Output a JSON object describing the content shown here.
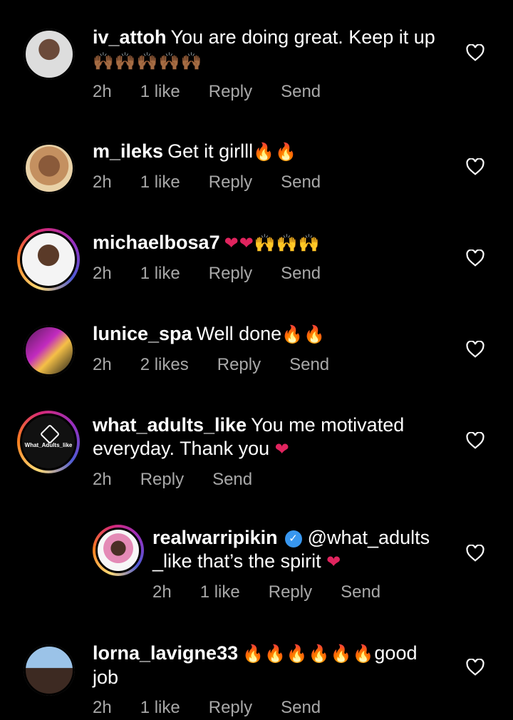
{
  "comments": [
    {
      "username": "iv_attoh",
      "text": "You are doing great. Keep it up",
      "emojis": "🙌🏾🙌🏾🙌🏾🙌🏾🙌🏾",
      "time": "2h",
      "likes": "1 like",
      "reply": "Reply",
      "send": "Send"
    },
    {
      "username": "m_ileks",
      "text": "Get it girlll",
      "emojis": "🔥🔥",
      "time": "2h",
      "likes": "1 like",
      "reply": "Reply",
      "send": "Send"
    },
    {
      "username": "michaelbosa7",
      "text": "",
      "emojis": "❤❤🙌🙌🙌",
      "time": "2h",
      "likes": "1 like",
      "reply": "Reply",
      "send": "Send"
    },
    {
      "username": "lunice_spa",
      "text": "Well done",
      "emojis": "🔥🔥",
      "time": "2h",
      "likes": "2 likes",
      "reply": "Reply",
      "send": "Send"
    },
    {
      "username": "what_adults_like",
      "text": "You me motivated everyday. Thank you",
      "emojis": "❤",
      "time": "2h",
      "reply": "Reply",
      "send": "Send",
      "avatar_text": "What_Adults_like"
    },
    {
      "username": "realwarripikin",
      "text": "@what_adults _like that’s the spirit",
      "emojis": "❤",
      "time": "2h",
      "likes": "1 like",
      "reply": "Reply",
      "send": "Send",
      "verified_icon": "✓"
    },
    {
      "username": "lorna_lavigne33",
      "text": "good job",
      "emojis": "🔥🔥🔥🔥🔥🔥",
      "time": "2h",
      "likes": "1 like",
      "reply": "Reply",
      "send": "Send"
    }
  ],
  "icons": {
    "like": "heart-outline-icon"
  },
  "colors": {
    "background": "#000000",
    "meta": "#a8a8a8",
    "heart_emoji": "#e0245e",
    "verified": "#3897f0"
  }
}
